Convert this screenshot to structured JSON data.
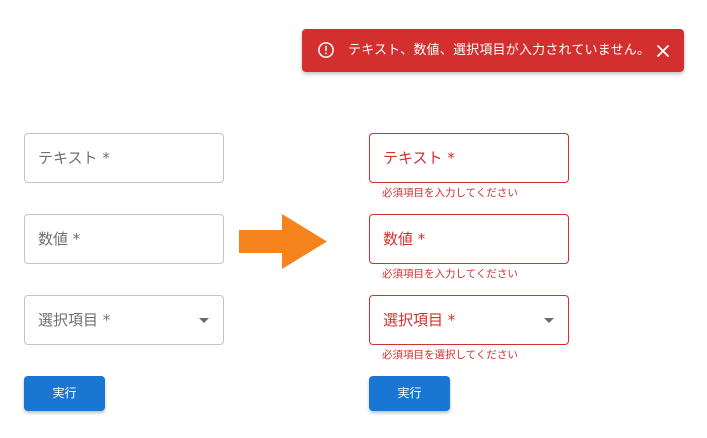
{
  "toast": {
    "message": "テキスト、数値、選択項目が入力されていません。",
    "icon": "error-outline-icon",
    "close_icon": "close-icon",
    "color": "#d32f2f"
  },
  "before": {
    "text_label": "テキスト *",
    "number_label": "数値 *",
    "select_label": "選択項目 *",
    "submit_label": "実行"
  },
  "after": {
    "text_label": "テキスト *",
    "text_helper": "必須項目を入力してください",
    "number_label": "数値 *",
    "number_helper": "必須項目を入力してください",
    "select_label": "選択項目 *",
    "select_helper": "必須項目を選択してください",
    "submit_label": "実行"
  },
  "colors": {
    "error": "#d32f2f",
    "primary": "#1976d2",
    "arrow": "#f5841f",
    "border": "#c4c4c4"
  }
}
